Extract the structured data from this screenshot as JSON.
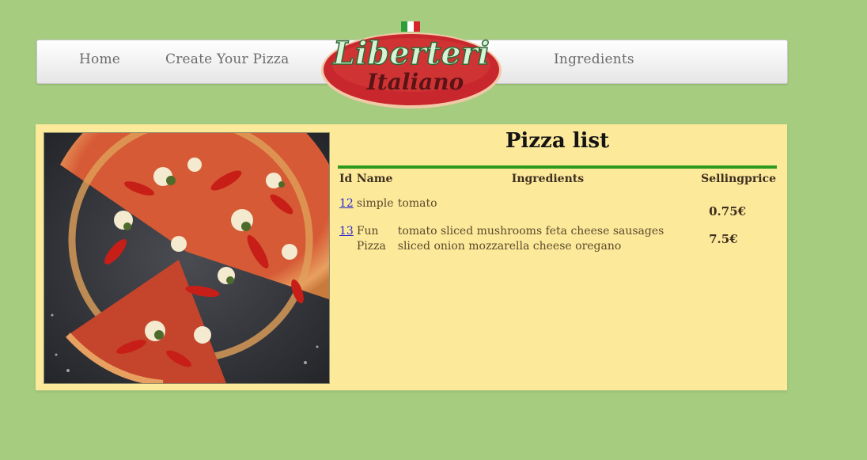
{
  "nav": {
    "home": "Home",
    "create": "Create Your Pizza",
    "ingredients": "Ingredients"
  },
  "logo": {
    "line1": "Liberteri",
    "line2": "Italiano"
  },
  "list": {
    "title": "Pizza list",
    "columns": {
      "id": "Id",
      "name": "Name",
      "ingredients": "Ingredients",
      "price": "Sellingprice"
    },
    "rows": [
      {
        "id": "12",
        "name": "simple",
        "ingredients": "tomato",
        "price": "0.75€"
      },
      {
        "id": "13",
        "name": "Fun Pizza",
        "ingredients": "tomato sliced mushrooms feta cheese sausages sliced onion mozzarella cheese oregano",
        "price": "7.5€"
      }
    ]
  },
  "colors": {
    "background": "#a6cd7f",
    "panel": "#fde99a",
    "accent_rule": "#2b9a1c",
    "logo_red": "#c8272d",
    "logo_mint": "#d8f2d8"
  },
  "icons": {
    "photo": "pizza-photo",
    "flag": "italian-flag-icon"
  }
}
